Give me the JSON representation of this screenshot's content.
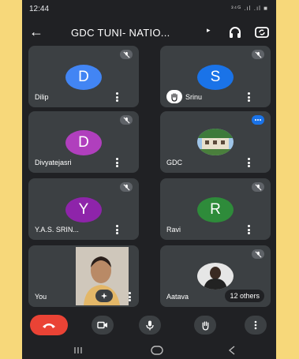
{
  "status_bar": {
    "time": "12:44",
    "indicators": "³⁴ᴳ .ıl .ıl ■"
  },
  "header": {
    "title": "GDC TUNI- NATIO...",
    "back_icon": "arrow-back-icon",
    "audio_icon": "headphones-icon",
    "camera_icon": "switch-camera-icon"
  },
  "participants": [
    {
      "name": "Dilip",
      "initial": "D",
      "color": "#4285f4",
      "muted": true
    },
    {
      "name": "Srinu",
      "initial": "S",
      "color": "#1a73e8",
      "muted": true,
      "hand_raised": true
    },
    {
      "name": "Divyatejasri",
      "initial": "D",
      "color": "#b03fbd",
      "muted": true
    },
    {
      "name": "GDC",
      "muted": false,
      "speaking": true,
      "photo": true
    },
    {
      "name": "Y.A.S. SRIN...",
      "initial": "Y",
      "color": "#8e24aa",
      "muted": true
    },
    {
      "name": "Ravi",
      "initial": "R",
      "color": "#2e8b3a",
      "muted": true
    },
    {
      "name": "You",
      "self_view": true
    },
    {
      "name": "Aatava",
      "photo": true,
      "muted": true,
      "others_label": "12 others"
    }
  ],
  "controls": [
    "end-call",
    "camera",
    "microphone",
    "raise-hand",
    "more"
  ],
  "nav": [
    "recents",
    "home",
    "back"
  ]
}
